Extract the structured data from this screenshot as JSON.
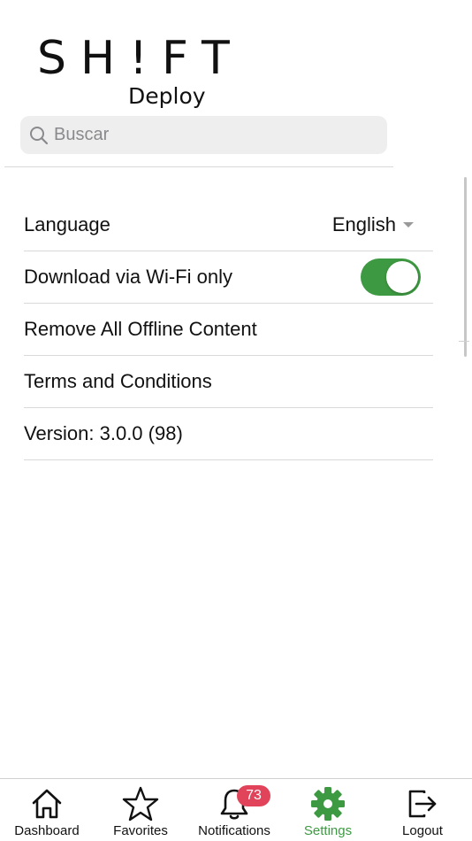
{
  "brand": {
    "wordmark": "SH!FT",
    "subtitle": "Deploy"
  },
  "search": {
    "placeholder": "Buscar",
    "value": ""
  },
  "settings": {
    "language": {
      "label": "Language",
      "value": "English"
    },
    "wifi": {
      "label": "Download via Wi-Fi only",
      "enabled": true
    },
    "remove_offline": {
      "label": "Remove All Offline Content"
    },
    "terms": {
      "label": "Terms and Conditions"
    },
    "version": {
      "label": "Version: 3.0.0 (98)"
    }
  },
  "tabbar": {
    "items": [
      {
        "label": "Dashboard",
        "icon": "home-icon"
      },
      {
        "label": "Favorites",
        "icon": "star-icon"
      },
      {
        "label": "Notifications",
        "icon": "bell-icon",
        "badge": "73"
      },
      {
        "label": "Settings",
        "icon": "gear-icon",
        "active": true
      },
      {
        "label": "Logout",
        "icon": "logout-icon"
      }
    ]
  },
  "colors": {
    "accent": "#3e9a42",
    "badge": "#e0435a",
    "search_bg": "#eeeeee"
  }
}
